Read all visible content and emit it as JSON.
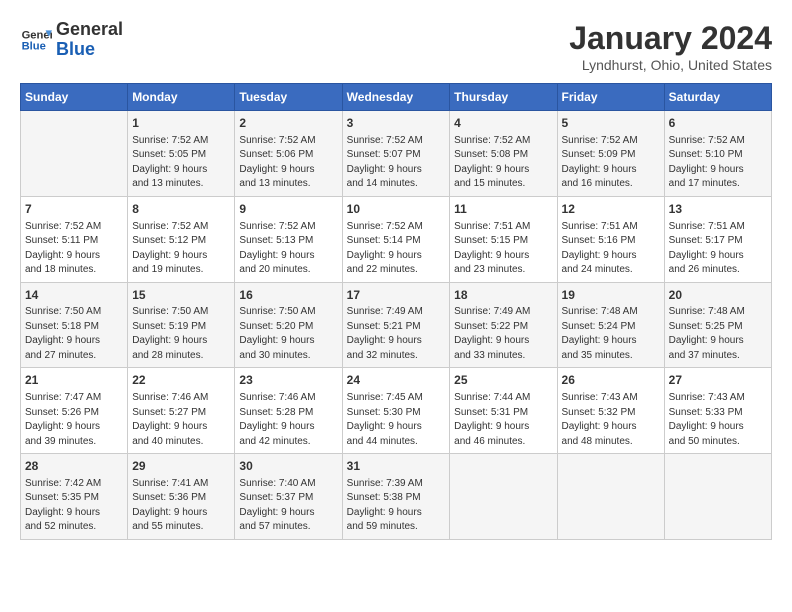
{
  "header": {
    "logo_line1": "General",
    "logo_line2": "Blue",
    "title": "January 2024",
    "subtitle": "Lyndhurst, Ohio, United States"
  },
  "weekdays": [
    "Sunday",
    "Monday",
    "Tuesday",
    "Wednesday",
    "Thursday",
    "Friday",
    "Saturday"
  ],
  "weeks": [
    [
      {
        "day": "",
        "data": ""
      },
      {
        "day": "1",
        "data": "Sunrise: 7:52 AM\nSunset: 5:05 PM\nDaylight: 9 hours\nand 13 minutes."
      },
      {
        "day": "2",
        "data": "Sunrise: 7:52 AM\nSunset: 5:06 PM\nDaylight: 9 hours\nand 13 minutes."
      },
      {
        "day": "3",
        "data": "Sunrise: 7:52 AM\nSunset: 5:07 PM\nDaylight: 9 hours\nand 14 minutes."
      },
      {
        "day": "4",
        "data": "Sunrise: 7:52 AM\nSunset: 5:08 PM\nDaylight: 9 hours\nand 15 minutes."
      },
      {
        "day": "5",
        "data": "Sunrise: 7:52 AM\nSunset: 5:09 PM\nDaylight: 9 hours\nand 16 minutes."
      },
      {
        "day": "6",
        "data": "Sunrise: 7:52 AM\nSunset: 5:10 PM\nDaylight: 9 hours\nand 17 minutes."
      }
    ],
    [
      {
        "day": "7",
        "data": "Sunrise: 7:52 AM\nSunset: 5:11 PM\nDaylight: 9 hours\nand 18 minutes."
      },
      {
        "day": "8",
        "data": "Sunrise: 7:52 AM\nSunset: 5:12 PM\nDaylight: 9 hours\nand 19 minutes."
      },
      {
        "day": "9",
        "data": "Sunrise: 7:52 AM\nSunset: 5:13 PM\nDaylight: 9 hours\nand 20 minutes."
      },
      {
        "day": "10",
        "data": "Sunrise: 7:52 AM\nSunset: 5:14 PM\nDaylight: 9 hours\nand 22 minutes."
      },
      {
        "day": "11",
        "data": "Sunrise: 7:51 AM\nSunset: 5:15 PM\nDaylight: 9 hours\nand 23 minutes."
      },
      {
        "day": "12",
        "data": "Sunrise: 7:51 AM\nSunset: 5:16 PM\nDaylight: 9 hours\nand 24 minutes."
      },
      {
        "day": "13",
        "data": "Sunrise: 7:51 AM\nSunset: 5:17 PM\nDaylight: 9 hours\nand 26 minutes."
      }
    ],
    [
      {
        "day": "14",
        "data": "Sunrise: 7:50 AM\nSunset: 5:18 PM\nDaylight: 9 hours\nand 27 minutes."
      },
      {
        "day": "15",
        "data": "Sunrise: 7:50 AM\nSunset: 5:19 PM\nDaylight: 9 hours\nand 28 minutes."
      },
      {
        "day": "16",
        "data": "Sunrise: 7:50 AM\nSunset: 5:20 PM\nDaylight: 9 hours\nand 30 minutes."
      },
      {
        "day": "17",
        "data": "Sunrise: 7:49 AM\nSunset: 5:21 PM\nDaylight: 9 hours\nand 32 minutes."
      },
      {
        "day": "18",
        "data": "Sunrise: 7:49 AM\nSunset: 5:22 PM\nDaylight: 9 hours\nand 33 minutes."
      },
      {
        "day": "19",
        "data": "Sunrise: 7:48 AM\nSunset: 5:24 PM\nDaylight: 9 hours\nand 35 minutes."
      },
      {
        "day": "20",
        "data": "Sunrise: 7:48 AM\nSunset: 5:25 PM\nDaylight: 9 hours\nand 37 minutes."
      }
    ],
    [
      {
        "day": "21",
        "data": "Sunrise: 7:47 AM\nSunset: 5:26 PM\nDaylight: 9 hours\nand 39 minutes."
      },
      {
        "day": "22",
        "data": "Sunrise: 7:46 AM\nSunset: 5:27 PM\nDaylight: 9 hours\nand 40 minutes."
      },
      {
        "day": "23",
        "data": "Sunrise: 7:46 AM\nSunset: 5:28 PM\nDaylight: 9 hours\nand 42 minutes."
      },
      {
        "day": "24",
        "data": "Sunrise: 7:45 AM\nSunset: 5:30 PM\nDaylight: 9 hours\nand 44 minutes."
      },
      {
        "day": "25",
        "data": "Sunrise: 7:44 AM\nSunset: 5:31 PM\nDaylight: 9 hours\nand 46 minutes."
      },
      {
        "day": "26",
        "data": "Sunrise: 7:43 AM\nSunset: 5:32 PM\nDaylight: 9 hours\nand 48 minutes."
      },
      {
        "day": "27",
        "data": "Sunrise: 7:43 AM\nSunset: 5:33 PM\nDaylight: 9 hours\nand 50 minutes."
      }
    ],
    [
      {
        "day": "28",
        "data": "Sunrise: 7:42 AM\nSunset: 5:35 PM\nDaylight: 9 hours\nand 52 minutes."
      },
      {
        "day": "29",
        "data": "Sunrise: 7:41 AM\nSunset: 5:36 PM\nDaylight: 9 hours\nand 55 minutes."
      },
      {
        "day": "30",
        "data": "Sunrise: 7:40 AM\nSunset: 5:37 PM\nDaylight: 9 hours\nand 57 minutes."
      },
      {
        "day": "31",
        "data": "Sunrise: 7:39 AM\nSunset: 5:38 PM\nDaylight: 9 hours\nand 59 minutes."
      },
      {
        "day": "",
        "data": ""
      },
      {
        "day": "",
        "data": ""
      },
      {
        "day": "",
        "data": ""
      }
    ]
  ]
}
